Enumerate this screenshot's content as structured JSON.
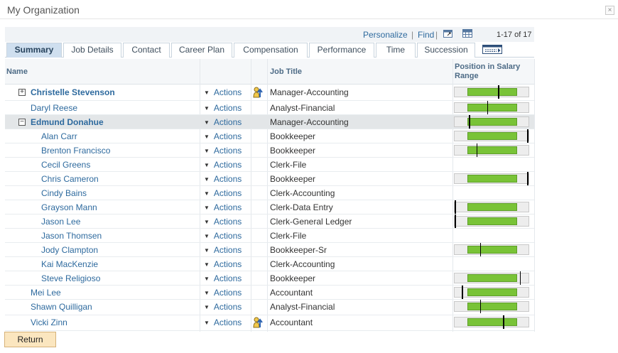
{
  "window": {
    "title": "My Organization",
    "close_symbol": "×"
  },
  "grid_nav": {
    "personalize": "Personalize",
    "separator": "|",
    "find": "Find",
    "count": "1-17 of 17"
  },
  "tabs": [
    {
      "label": "Summary",
      "active": true
    },
    {
      "label": "Job Details",
      "active": false
    },
    {
      "label": "Contact",
      "active": false
    },
    {
      "label": "Career Plan",
      "active": false
    },
    {
      "label": "Compensation",
      "active": false
    },
    {
      "label": "Performance",
      "active": false
    },
    {
      "label": "Time",
      "active": false
    },
    {
      "label": "Succession",
      "active": false
    }
  ],
  "columns": {
    "name": "Name",
    "job_title": "Job Title",
    "salary_line1": "Position in Salary",
    "salary_line2": "Range"
  },
  "actions_label": "Actions",
  "rows": [
    {
      "name": "Christelle Stevenson",
      "level": 1,
      "bold": true,
      "expander": "+",
      "icon": true,
      "job": "Manager-Accounting",
      "salary": 0.6,
      "selected": false
    },
    {
      "name": "Daryl Reese",
      "level": 1,
      "bold": false,
      "expander": "",
      "icon": false,
      "job": "Analyst-Financial",
      "salary": 0.45,
      "selected": false
    },
    {
      "name": "Edmund Donahue",
      "level": 1,
      "bold": true,
      "expander": "−",
      "icon": false,
      "job": "Manager-Accounting",
      "salary": 0.2,
      "selected": true
    },
    {
      "name": "Alan Carr",
      "level": 2,
      "bold": false,
      "expander": "",
      "icon": false,
      "job": "Bookkeeper",
      "salary": 1.0,
      "selected": false
    },
    {
      "name": "Brenton Francisco",
      "level": 2,
      "bold": false,
      "expander": "",
      "icon": false,
      "job": "Bookkeeper",
      "salary": 0.3,
      "selected": false
    },
    {
      "name": "Cecil Greens",
      "level": 2,
      "bold": false,
      "expander": "",
      "icon": false,
      "job": "Clerk-File",
      "salary": null,
      "selected": false
    },
    {
      "name": "Chris Cameron",
      "level": 2,
      "bold": false,
      "expander": "",
      "icon": false,
      "job": "Bookkeeper",
      "salary": 1.0,
      "selected": false
    },
    {
      "name": "Cindy Bains",
      "level": 2,
      "bold": false,
      "expander": "",
      "icon": false,
      "job": "Clerk-Accounting",
      "salary": null,
      "selected": false
    },
    {
      "name": "Grayson Mann",
      "level": 2,
      "bold": false,
      "expander": "",
      "icon": false,
      "job": "Clerk-Data Entry",
      "salary": 0.0,
      "selected": false
    },
    {
      "name": "Jason Lee",
      "level": 2,
      "bold": false,
      "expander": "",
      "icon": false,
      "job": "Clerk-General Ledger",
      "salary": 0.0,
      "selected": false
    },
    {
      "name": "Jason Thomsen",
      "level": 2,
      "bold": false,
      "expander": "",
      "icon": false,
      "job": "Clerk-File",
      "salary": null,
      "selected": false
    },
    {
      "name": "Jody Clampton",
      "level": 2,
      "bold": false,
      "expander": "",
      "icon": false,
      "job": "Bookkeeper-Sr",
      "salary": 0.35,
      "selected": false
    },
    {
      "name": "Kai MacKenzie",
      "level": 2,
      "bold": false,
      "expander": "",
      "icon": false,
      "job": "Clerk-Accounting",
      "salary": null,
      "selected": false
    },
    {
      "name": "Steve Religioso",
      "level": 2,
      "bold": false,
      "expander": "",
      "icon": false,
      "job": "Bookkeeper",
      "salary": 0.9,
      "selected": false
    },
    {
      "name": "Mei Lee",
      "level": 1,
      "bold": false,
      "expander": "",
      "icon": false,
      "job": "Accountant",
      "salary": 0.1,
      "selected": false
    },
    {
      "name": "Shawn Quilligan",
      "level": 1,
      "bold": false,
      "expander": "",
      "icon": false,
      "job": "Analyst-Financial",
      "salary": 0.35,
      "selected": false
    },
    {
      "name": "Vicki Zinn",
      "level": 1,
      "bold": false,
      "expander": "",
      "icon": true,
      "job": "Accountant",
      "salary": 0.67,
      "selected": false
    }
  ],
  "return_label": "Return"
}
